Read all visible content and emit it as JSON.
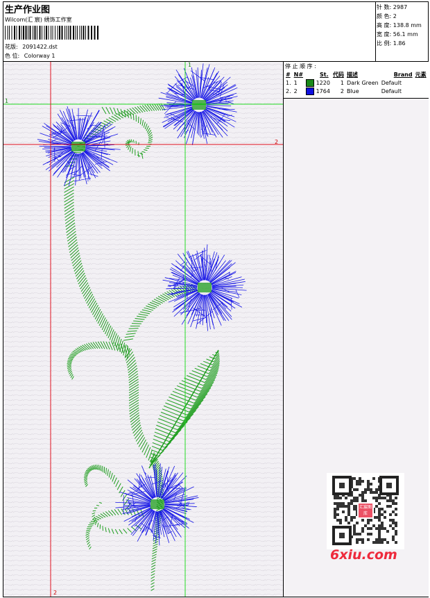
{
  "header": {
    "title": "生产作业图",
    "company": "Wilcom(汇 宸) 绣饰工作室",
    "design_label": "花版:",
    "design_value": "2091422.dst",
    "colorway_label": "色 位:",
    "colorway_value": "Colorway 1"
  },
  "stats": {
    "stitches_label": "针 数:",
    "stitches_value": "2987",
    "colors_label": "颜 色:",
    "colors_value": "2",
    "height_label": "高 度:",
    "height_value": "138.8 mm",
    "width_label": "宽 度:",
    "width_value": "56.1 mm",
    "ratio_label": "比 例:",
    "ratio_value": "1.86"
  },
  "guides": {
    "h1": "1",
    "h2": "2",
    "v1": "1",
    "v2": "2"
  },
  "stop_sequence": {
    "title": "停 止 顺 序 :",
    "columns": [
      "#",
      "N#",
      "St.",
      "代码",
      "描述",
      "Brand",
      "元素"
    ],
    "rows": [
      {
        "num": "1.",
        "n": "1",
        "color": "#1a8a1a",
        "st": "1220",
        "code": "1",
        "desc": "Dark Green",
        "brand": "Default",
        "element": ""
      },
      {
        "num": "2.",
        "n": "2",
        "color": "#1010e0",
        "st": "1764",
        "code": "2",
        "desc": "Blue",
        "brand": "Default",
        "element": ""
      }
    ]
  },
  "watermark": {
    "text": "6xiu.com",
    "qr_badge": "汇宸图库"
  },
  "colors": {
    "green": "#1f9e1f",
    "blue": "#1414e6",
    "red_guide": "#e0101e",
    "green_guide": "#22dd22"
  }
}
